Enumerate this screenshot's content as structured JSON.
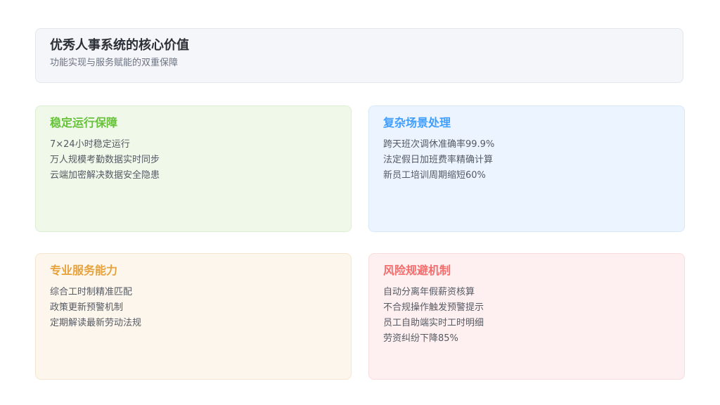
{
  "header": {
    "title": "优秀人事系统的核心价值",
    "subtitle": "功能实现与服务赋能的双重保障"
  },
  "cards": [
    {
      "title": "稳定运行保障",
      "color": "#67c23a",
      "items": [
        "7×24小时稳定运行",
        "万人规模考勤数据实时同步",
        "云端加密解决数据安全隐患"
      ]
    },
    {
      "title": "复杂场景处理",
      "color": "#409eff",
      "items": [
        "跨天班次调休准确率99.9%",
        "法定假日加班费率精确计算",
        "新员工培训周期缩短60%"
      ]
    },
    {
      "title": "专业服务能力",
      "color": "#e6a23c",
      "items": [
        "综合工时制精准匹配",
        "政策更新预警机制",
        "定期解读最新劳动法规"
      ]
    },
    {
      "title": "风险规避机制",
      "color": "#f56c6c",
      "items": [
        "自动分离年假薪资核算",
        "不合规操作触发预警提示",
        "员工自助端实时工时明细",
        "劳资纠纷下降85%"
      ]
    }
  ]
}
